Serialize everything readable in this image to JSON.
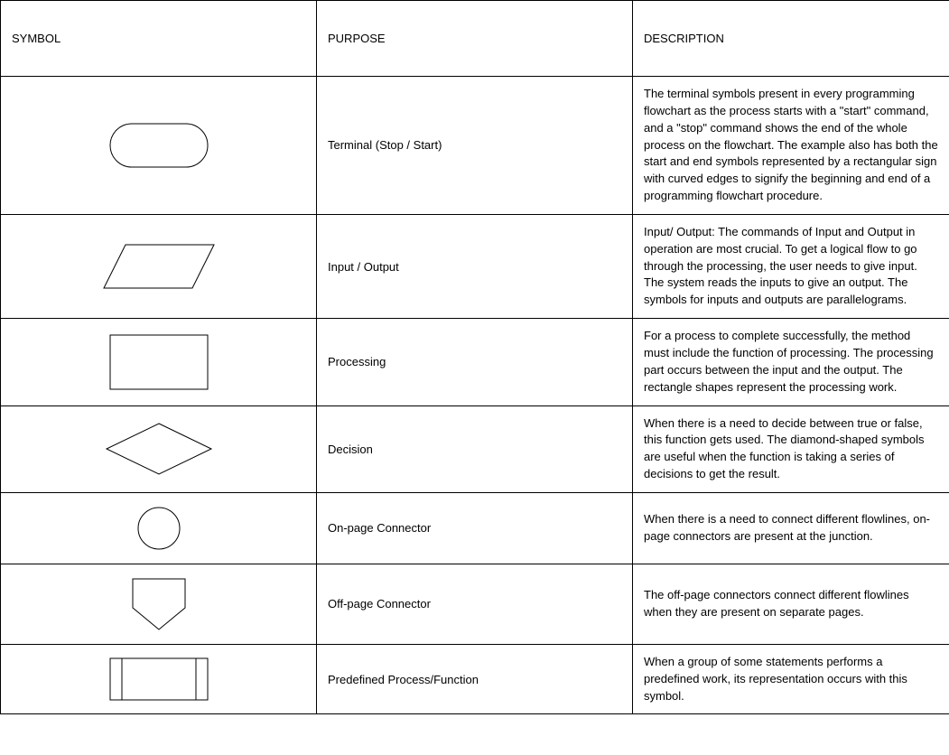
{
  "headers": {
    "symbol": "SYMBOL",
    "purpose": "PURPOSE",
    "description": "DESCRIPTION"
  },
  "rows": [
    {
      "purpose": "Terminal (Stop / Start)",
      "description": "The terminal symbols present in every programming flowchart as the process starts with a \"start\" command, and a \"stop\" command shows the end of the whole process on the flowchart. The example also has both the start and end symbols represented by a rectangular sign with curved edges to signify the beginning and end of a programming flowchart procedure."
    },
    {
      "purpose": "Input / Output",
      "description": "Input/ Output: The commands of Input and Output in operation are most crucial. To get a logical flow to go through the processing, the user needs to give input. The system reads the inputs to give an output. The symbols for inputs and outputs are parallelograms."
    },
    {
      "purpose": "Processing",
      "description": " For a process to complete successfully, the method must include the function of processing. The processing part occurs between the input and the output. The rectangle shapes represent the processing work."
    },
    {
      "purpose": "Decision",
      "description": "When there is a need to decide between true or false, this function gets used. The diamond-shaped symbols are useful when the function is taking a series of decisions to get the result."
    },
    {
      "purpose": "On-page Connector",
      "description": "When there is a need to connect different flowlines, on-page connectors are present at the junction."
    },
    {
      "purpose": "Off-page Connector",
      "description": "The off-page connectors connect different flowlines when they are present on separate pages."
    },
    {
      "purpose": "Predefined Process/Function",
      "description": "When a group of some statements performs a predefined work, its representation occurs with this symbol."
    }
  ]
}
